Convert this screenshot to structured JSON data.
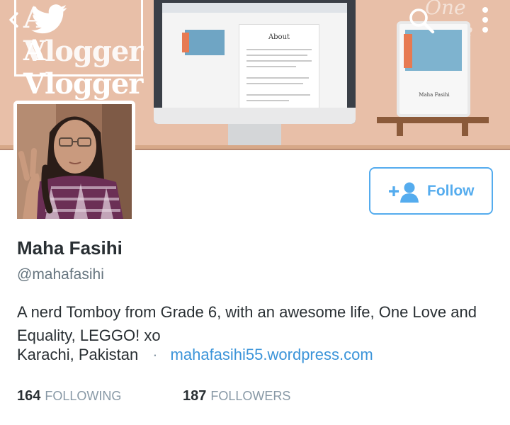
{
  "header": {
    "banner_line1": "A Vlogger",
    "banner_line2": "A Vlogger",
    "monitor_heading": "About",
    "tablet_caption": "Maha Fasihi",
    "banner_script": "One Love"
  },
  "profile": {
    "name": "Maha Fasihi",
    "handle": "@mahafasihi",
    "bio": "A nerd Tomboy from Grade 6, with an awesome life, One Love and Equality, LEGGO! xo",
    "location": "Karachi, Pakistan",
    "separator": "·",
    "website": "mahafasihi55.wordpress.com"
  },
  "actions": {
    "follow_label": "Follow"
  },
  "stats": {
    "following_count": "164",
    "following_label": "FOLLOWING",
    "followers_count": "187",
    "followers_label": "FOLLOWERS"
  },
  "colors": {
    "accent": "#55acee",
    "link": "#3b94d9",
    "header_bg": "#e8bfa8",
    "text": "#292f33",
    "muted": "#8899a6"
  },
  "icons": {
    "back": "back-chevron-icon",
    "logo": "twitter-bird-icon",
    "search": "search-icon",
    "more": "more-vertical-icon",
    "follow": "add-user-icon"
  }
}
